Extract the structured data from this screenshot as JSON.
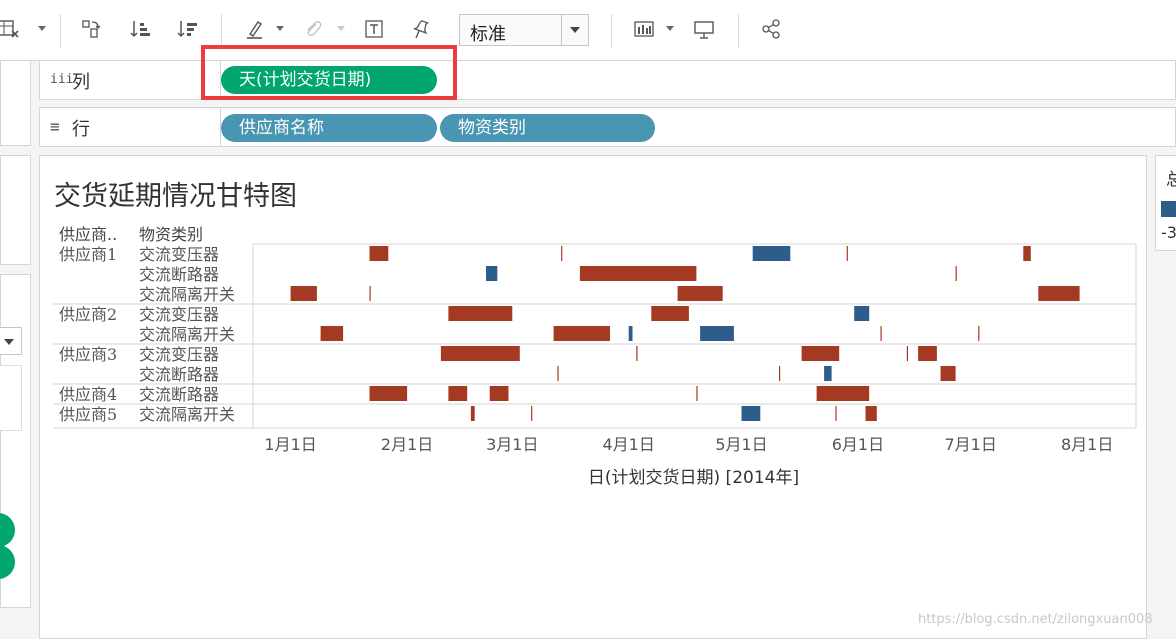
{
  "toolbar": {
    "fit_value": "标准",
    "icons": [
      "clear-sheet-icon",
      "swap-icon",
      "sort-ascending-icon",
      "sort-descending-icon",
      "highlight-icon",
      "attachment-icon",
      "text-label-icon",
      "pin-icon",
      "show-me-icon",
      "presentation-icon",
      "share-icon"
    ]
  },
  "shelves": {
    "columns": {
      "label": "列",
      "icon": "iii",
      "pills": [
        {
          "text": "天(计划交货日期)",
          "color": "#00a66e"
        }
      ]
    },
    "rows": {
      "label": "行",
      "icon": "≡",
      "pills": [
        {
          "text": "供应商名称",
          "color": "#4996b2"
        },
        {
          "text": "物资类别",
          "color": "#4996b2"
        }
      ]
    }
  },
  "view": {
    "title": "交货延期情况甘特图",
    "header_supplier": "供应商..",
    "header_category": "物资类别"
  },
  "legend": {
    "title": "总",
    "swatch_color": "#2e5d8c",
    "value": "-3"
  },
  "watermark": "https://blog.csdn.net/zilongxuan008",
  "chart_data": {
    "type": "gantt",
    "title": "交货延期情况甘特图",
    "xlabel": "日(计划交货日期) [2014年]",
    "x_ticks": [
      "1月1日",
      "2月1日",
      "3月1日",
      "4月1日",
      "5月1日",
      "6月1日",
      "7月1日",
      "8月1日"
    ],
    "x_range": [
      "2013-12-22",
      "2014-08-14"
    ],
    "colors": {
      "delay": "#a53a22",
      "early": "#2e5d8c"
    },
    "rows": [
      {
        "supplier": "供应商1",
        "category": "交流变压器",
        "bars": [
          {
            "start": "2014-01-22",
            "days": 5,
            "type": "delay"
          },
          {
            "start": "2014-03-14",
            "days": 0,
            "type": "delay"
          },
          {
            "start": "2014-05-04",
            "days": 10,
            "type": "early"
          },
          {
            "start": "2014-05-29",
            "days": 0,
            "type": "delay"
          },
          {
            "start": "2014-07-15",
            "days": 2,
            "type": "delay"
          }
        ]
      },
      {
        "supplier": "",
        "category": "交流断路器",
        "bars": [
          {
            "start": "2014-02-22",
            "days": 3,
            "type": "early"
          },
          {
            "start": "2014-03-19",
            "days": 31,
            "type": "delay"
          },
          {
            "start": "2014-06-27",
            "days": 0,
            "type": "delay"
          }
        ]
      },
      {
        "supplier": "",
        "category": "交流隔离开关",
        "bars": [
          {
            "start": "2014-01-01",
            "days": 7,
            "type": "delay"
          },
          {
            "start": "2014-01-22",
            "days": 0,
            "type": "delay"
          },
          {
            "start": "2014-04-14",
            "days": 12,
            "type": "delay"
          },
          {
            "start": "2014-07-19",
            "days": 11,
            "type": "delay"
          }
        ]
      },
      {
        "supplier": "供应商2",
        "category": "交流变压器",
        "bars": [
          {
            "start": "2014-02-12",
            "days": 17,
            "type": "delay"
          },
          {
            "start": "2014-04-07",
            "days": 10,
            "type": "delay"
          },
          {
            "start": "2014-05-31",
            "days": 4,
            "type": "early"
          }
        ]
      },
      {
        "supplier": "",
        "category": "交流隔离开关",
        "bars": [
          {
            "start": "2014-01-09",
            "days": 6,
            "type": "delay"
          },
          {
            "start": "2014-03-12",
            "days": 15,
            "type": "delay"
          },
          {
            "start": "2014-04-01",
            "days": 1,
            "type": "early"
          },
          {
            "start": "2014-04-20",
            "days": 9,
            "type": "early"
          },
          {
            "start": "2014-06-07",
            "days": 0,
            "type": "delay"
          },
          {
            "start": "2014-07-03",
            "days": 0,
            "type": "delay"
          }
        ]
      },
      {
        "supplier": "供应商3",
        "category": "交流变压器",
        "bars": [
          {
            "start": "2014-02-10",
            "days": 21,
            "type": "delay"
          },
          {
            "start": "2014-04-03",
            "days": 0,
            "type": "delay"
          },
          {
            "start": "2014-05-17",
            "days": 10,
            "type": "delay"
          },
          {
            "start": "2014-06-14",
            "days": 0,
            "type": "delay"
          },
          {
            "start": "2014-06-17",
            "days": 5,
            "type": "delay"
          }
        ]
      },
      {
        "supplier": "",
        "category": "交流断路器",
        "bars": [
          {
            "start": "2014-03-13",
            "days": 0,
            "type": "delay"
          },
          {
            "start": "2014-05-11",
            "days": 0,
            "type": "delay"
          },
          {
            "start": "2014-05-23",
            "days": 2,
            "type": "early"
          },
          {
            "start": "2014-06-23",
            "days": 4,
            "type": "delay"
          }
        ]
      },
      {
        "supplier": "供应商4",
        "category": "交流断路器",
        "bars": [
          {
            "start": "2014-01-22",
            "days": 10,
            "type": "delay"
          },
          {
            "start": "2014-02-12",
            "days": 5,
            "type": "delay"
          },
          {
            "start": "2014-02-23",
            "days": 5,
            "type": "delay"
          },
          {
            "start": "2014-04-19",
            "days": 0,
            "type": "delay"
          },
          {
            "start": "2014-05-21",
            "days": 14,
            "type": "delay"
          }
        ]
      },
      {
        "supplier": "供应商5",
        "category": "交流隔离开关",
        "bars": [
          {
            "start": "2014-02-18",
            "days": 1,
            "type": "delay"
          },
          {
            "start": "2014-03-06",
            "days": 0,
            "type": "delay"
          },
          {
            "start": "2014-05-01",
            "days": 5,
            "type": "early"
          },
          {
            "start": "2014-05-26",
            "days": 0,
            "type": "delay"
          },
          {
            "start": "2014-06-03",
            "days": 3,
            "type": "delay"
          }
        ]
      }
    ]
  }
}
